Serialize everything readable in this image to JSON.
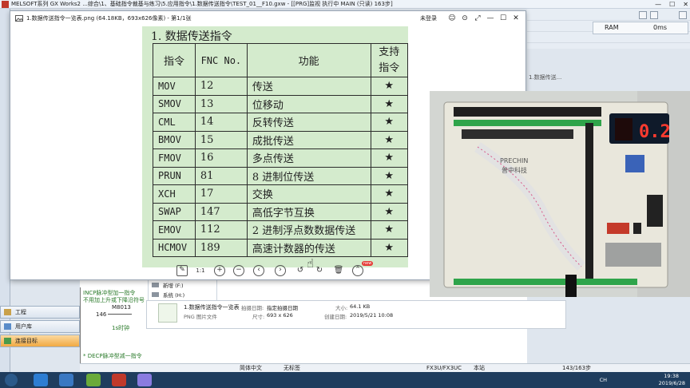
{
  "gx": {
    "title": "MELSOFT系列 GX Works2 ...综合\\1、基础指令裁基与练习\\5.应用指令\\1.数据传送指令\\TEST_01__F10.gxw - [[PRG]监视 执行中 MAIN (只读) 163步]",
    "ram_label": "RAM",
    "ms_value": "0ms",
    "left_labels": [
      "工程",
      "用户库",
      "连接目标"
    ],
    "ladder_texts": [
      "1.数据传送...",
      "INCP脉冲型加一指令",
      "不用加上升或下降沿符号",
      "M8013",
      "146",
      "1s时钟",
      "* DECP脉冲型减一指令"
    ],
    "drives": [
      "新增 (F:)",
      "系统 (H:)"
    ],
    "status": [
      "简体中文",
      "无标签",
      "FX3U/FX3UC",
      "本站",
      "143/163步"
    ]
  },
  "viewer": {
    "title": "1.数据传送指令一览表.png (64.18KB，693x626像素) - 第1/1张",
    "login": "未登录",
    "new_badge": "new",
    "toolbar_icons": [
      "edit-icon",
      "actual-size-icon",
      "zoom-in-icon",
      "zoom-out-icon",
      "previous-icon",
      "next-icon",
      "rotate-left-icon",
      "rotate-right-icon",
      "delete-icon",
      "more-icon"
    ],
    "actual_size_label": "1:1"
  },
  "doc": {
    "heading": "1. 数据传送指令",
    "headers": [
      "指令",
      "FNC No.",
      "功能",
      "支持\n指令"
    ],
    "rows": [
      [
        "MOV",
        "12",
        "传送",
        "★"
      ],
      [
        "SMOV",
        "13",
        "位移动",
        "★"
      ],
      [
        "CML",
        "14",
        "反转传送",
        "★"
      ],
      [
        "BMOV",
        "15",
        "成批传送",
        "★"
      ],
      [
        "FMOV",
        "16",
        "多点传送",
        "★"
      ],
      [
        "PRUN",
        "81",
        "8 进制位传送",
        "★"
      ],
      [
        "XCH",
        "17",
        "交换",
        "★"
      ],
      [
        "SWAP",
        "147",
        "高低字节互换",
        "★"
      ],
      [
        "EMOV",
        "112",
        "2 进制浮点数数据传送",
        "★"
      ],
      [
        "HCMOV",
        "189",
        "高速计数器的传送",
        "★"
      ]
    ]
  },
  "file_info": {
    "name": "1.数据传送指令一览表",
    "type": "PNG 图片文件",
    "shot_date_label": "拍摄日期:",
    "shot_date_value": "指定拍摄日期",
    "dims_label": "尺寸:",
    "dims_value": "693 x 626",
    "size_label": "大小:",
    "size_value": "64.1 KB",
    "created_label": "创建日期:",
    "created_value": "2019/5/21 10:08"
  },
  "photo": {
    "display_value": "0.2",
    "brand": "PRECHIN",
    "brand_cn": "普中科技"
  },
  "taskbar": {
    "time": "19:38",
    "date": "2019/6/28",
    "ime": "CH"
  }
}
